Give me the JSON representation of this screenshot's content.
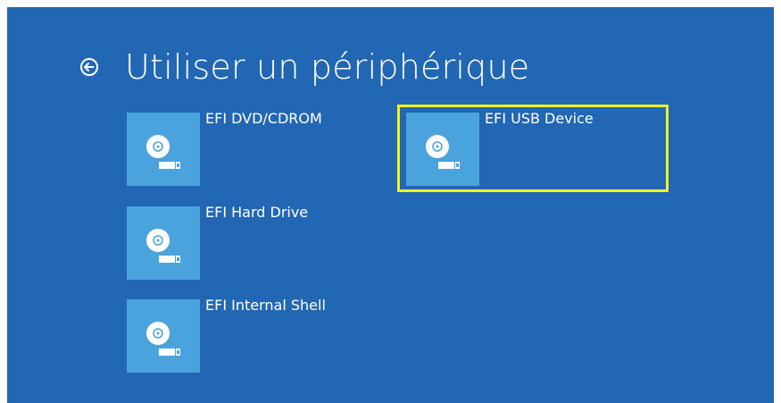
{
  "page": {
    "title": "Utiliser un périphérique",
    "back_icon": "back-arrow-circle-icon"
  },
  "devices": [
    {
      "label": "EFI DVD/CDROM",
      "icon": "disk-drive-icon",
      "selected": false
    },
    {
      "label": "EFI USB Device",
      "icon": "disk-drive-icon",
      "selected": true
    },
    {
      "label": "EFI Hard Drive",
      "icon": "disk-drive-icon",
      "selected": false
    },
    {
      "label": "EFI Internal Shell",
      "icon": "disk-drive-icon",
      "selected": false
    }
  ],
  "colors": {
    "background": "#2267b3",
    "tile": "#4aa3dc",
    "selection": "#f2f21e",
    "text": "#ffffff"
  }
}
